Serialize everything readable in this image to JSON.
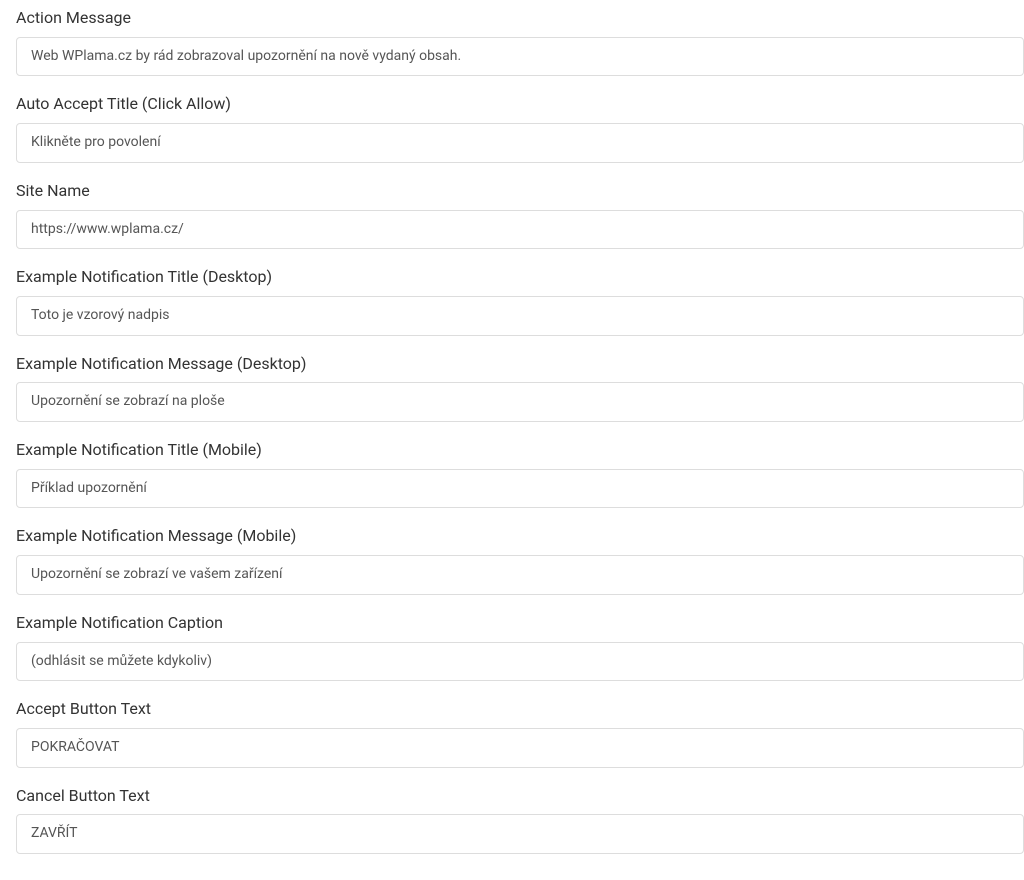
{
  "fields": [
    {
      "label": "Action Message",
      "value": "Web WPlama.cz by rád zobrazoval upozornění na nově vydaný obsah.",
      "name": "action-message-input"
    },
    {
      "label": "Auto Accept Title (Click Allow)",
      "value": "Klikněte pro povolení",
      "name": "auto-accept-title-input"
    },
    {
      "label": "Site Name",
      "value": "https://www.wplama.cz/",
      "name": "site-name-input"
    },
    {
      "label": "Example Notification Title (Desktop)",
      "value": "Toto je vzorový nadpis",
      "name": "example-title-desktop-input"
    },
    {
      "label": "Example Notification Message (Desktop)",
      "value": "Upozornění se zobrazí na ploše",
      "name": "example-message-desktop-input"
    },
    {
      "label": "Example Notification Title (Mobile)",
      "value": "Příklad upozornění",
      "name": "example-title-mobile-input"
    },
    {
      "label": "Example Notification Message (Mobile)",
      "value": "Upozornění se zobrazí ve vašem zařízení",
      "name": "example-message-mobile-input"
    },
    {
      "label": "Example Notification Caption",
      "value": "(odhlásit se můžete kdykoliv)",
      "name": "example-caption-input"
    },
    {
      "label": "Accept Button Text",
      "value": "POKRAČOVAT",
      "name": "accept-button-text-input"
    },
    {
      "label": "Cancel Button Text",
      "value": "ZAVŘÍT",
      "name": "cancel-button-text-input"
    }
  ]
}
